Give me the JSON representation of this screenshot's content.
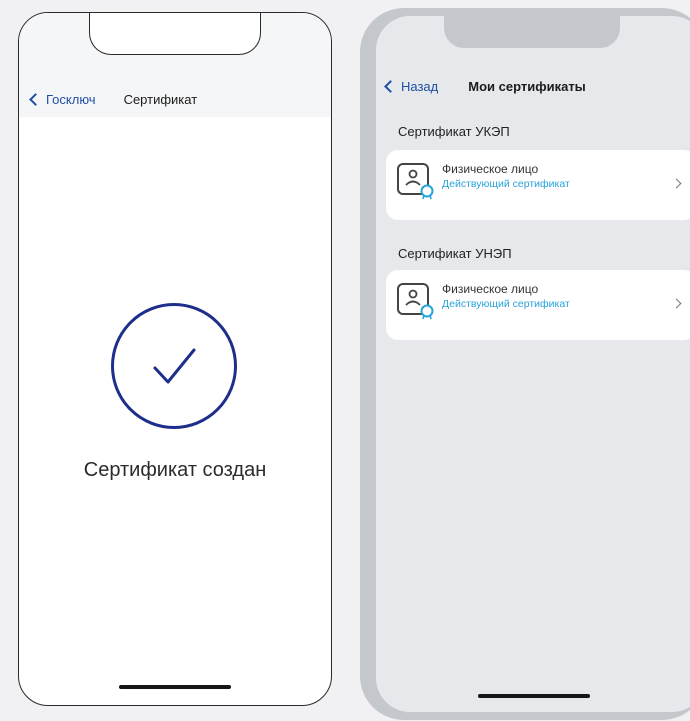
{
  "left_screen": {
    "back_label": "Госключ",
    "title": "Сертификат",
    "success_text": "Сертификат создан"
  },
  "right_screen": {
    "back_label": "Назад",
    "title": "Мои сертификаты",
    "sections": [
      {
        "title": "Сертификат УКЭП",
        "card": {
          "name": "Физическое лицо",
          "status": "Действующий сертификат"
        }
      },
      {
        "title": "Сертификат УНЭП",
        "card": {
          "name": "Физическое лицо",
          "status": "Действующий сертификат"
        }
      }
    ]
  },
  "colors": {
    "accent": "#1d4fa3",
    "success_ring": "#1d2f8a",
    "status_text": "#2aa3d8"
  },
  "icons": [
    "chevron-left-icon",
    "check-icon",
    "certificate-icon",
    "chevron-right-icon"
  ]
}
